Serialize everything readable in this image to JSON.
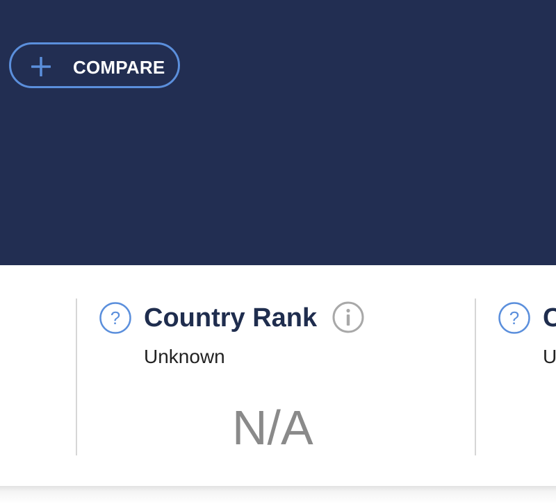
{
  "header": {
    "compare_label": "COMPARE",
    "background_color": "#222e52",
    "accent_color": "#5b8fdc"
  },
  "cards": [
    {
      "title": "Country Rank",
      "subtitle": "Unknown",
      "value": "N/A",
      "help_icon": "question-circle-icon",
      "info_icon": "info-circle-icon"
    },
    {
      "title": "C",
      "subtitle": "U",
      "help_icon": "question-circle-icon"
    }
  ]
}
